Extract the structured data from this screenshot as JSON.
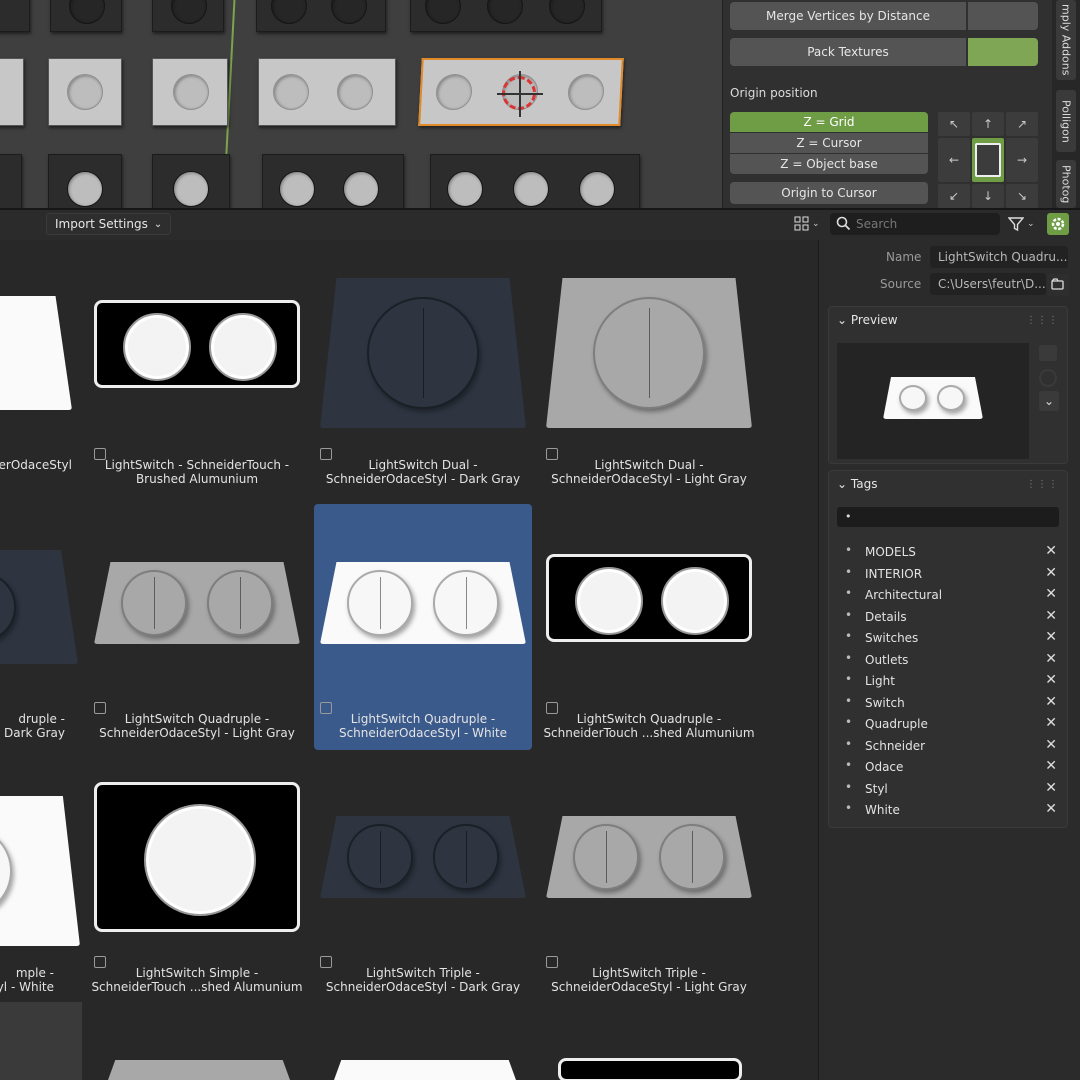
{
  "n_panel": {
    "merge_vertices_label": "Merge Vertices by Distance",
    "pack_textures_label": "Pack Textures",
    "origin_position_label": "Origin position",
    "origin_options": [
      "Z = Grid",
      "Z = Cursor",
      "Z = Object base"
    ],
    "origin_to_cursor_label": "Origin to Cursor",
    "arrows": [
      "↖",
      "↑",
      "↗",
      "←",
      "",
      "→",
      "↙",
      "↓",
      "↘"
    ],
    "tabs": [
      "mply Addons",
      "Polligon",
      "Photog"
    ],
    "accent_color": "#6f9d46"
  },
  "toolbar": {
    "import_settings_label": "Import Settings",
    "search_placeholder": "Search"
  },
  "assets": [
    {
      "caption": "LightSwitch - SchneiderTouch -\nBrushed Alumunium",
      "style": "black",
      "count": 2,
      "shape": "rect",
      "selected": false
    },
    {
      "caption": "LightSwitch Dual -\nSchneiderOdaceStyl - Dark Gray",
      "style": "dark",
      "count": 1,
      "shape": "trap",
      "selected": false
    },
    {
      "caption": "LightSwitch Dual -\nSchneiderOdaceStyl - Light Gray",
      "style": "gray",
      "count": 1,
      "shape": "trap",
      "selected": false
    },
    {
      "caption": "LightSwitch Quadruple -\nSchneiderOdaceStyl - Light Gray",
      "style": "gray",
      "count": 2,
      "shape": "trap",
      "selected": false
    },
    {
      "caption": "LightSwitch Quadruple -\nSchneiderOdaceStyl - White",
      "style": "white",
      "count": 2,
      "shape": "trap",
      "selected": true
    },
    {
      "caption": "LightSwitch Quadruple -\nSchneiderTouch ...shed Alumunium",
      "style": "black",
      "count": 2,
      "shape": "rect",
      "selected": false
    },
    {
      "caption": "LightSwitch Simple -\nSchneiderTouch ...shed Alumunium",
      "style": "black",
      "count": 1,
      "shape": "rect",
      "selected": false
    },
    {
      "caption": "LightSwitch Triple -\nSchneiderOdaceStyl - Dark Gray",
      "style": "dark",
      "count": 2,
      "shape": "trap",
      "selected": false
    },
    {
      "caption": "LightSwitch Triple -\nSchneiderOdaceStyl - Light Gray",
      "style": "gray",
      "count": 2,
      "shape": "trap",
      "selected": false
    }
  ],
  "partial_captions": [
    "erOdaceStyl",
    "druple -\n- Dark Gray",
    "mple -\nyl - White"
  ],
  "details": {
    "name_label": "Name",
    "name_value": "LightSwitch Quadru...",
    "source_label": "Source",
    "source_value": "C:\\Users\\feutr\\D...",
    "preview_label": "Preview",
    "tags_label": "Tags",
    "tag_input_value": "•",
    "tags": [
      "MODELS",
      "INTERIOR",
      "Architectural",
      "Details",
      "Switches",
      "Outlets",
      "Light",
      "Switch",
      "Quadruple",
      "Schneider",
      "Odace",
      "Styl",
      "White"
    ]
  }
}
